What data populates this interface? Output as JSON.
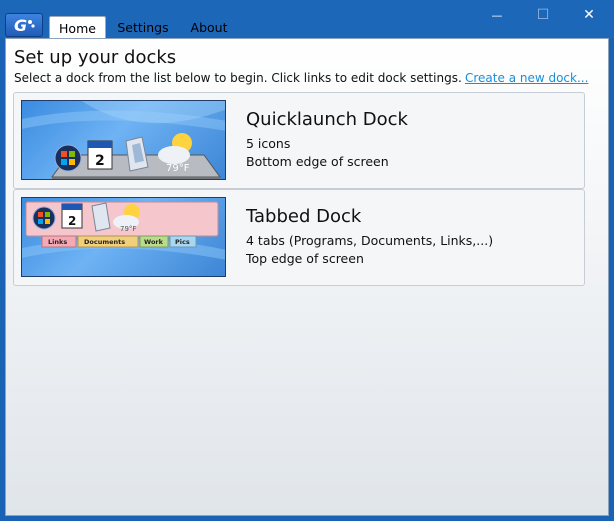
{
  "window": {
    "tabs": [
      {
        "label": "Home"
      },
      {
        "label": "Settings"
      },
      {
        "label": "About"
      }
    ],
    "controls": {
      "minimize": "—",
      "maximize": "☐",
      "close": "✕"
    }
  },
  "main": {
    "title": "Set up your docks",
    "subtitle": "Select a dock from the list below to begin. Click links to edit dock settings.",
    "create_link": "Create a new dock...",
    "docks": [
      {
        "name": "Quicklaunch Dock",
        "line1": "5 icons",
        "line2": "Bottom edge of screen",
        "preview": {
          "calendar_day": "2",
          "weather_temp": "79°F"
        }
      },
      {
        "name": "Tabbed Dock",
        "line1": "4 tabs (Programs, Documents, Links,...)",
        "line2": "Top edge of screen",
        "preview": {
          "calendar_day": "2",
          "weather_temp": "79°F",
          "tabs": [
            "Links",
            "Documents",
            "Work",
            "Pics"
          ]
        }
      }
    ]
  },
  "colors": {
    "titlebar": "#1d67b9",
    "link": "#1a8fd8",
    "thumb_bg": "#3a8be0"
  }
}
